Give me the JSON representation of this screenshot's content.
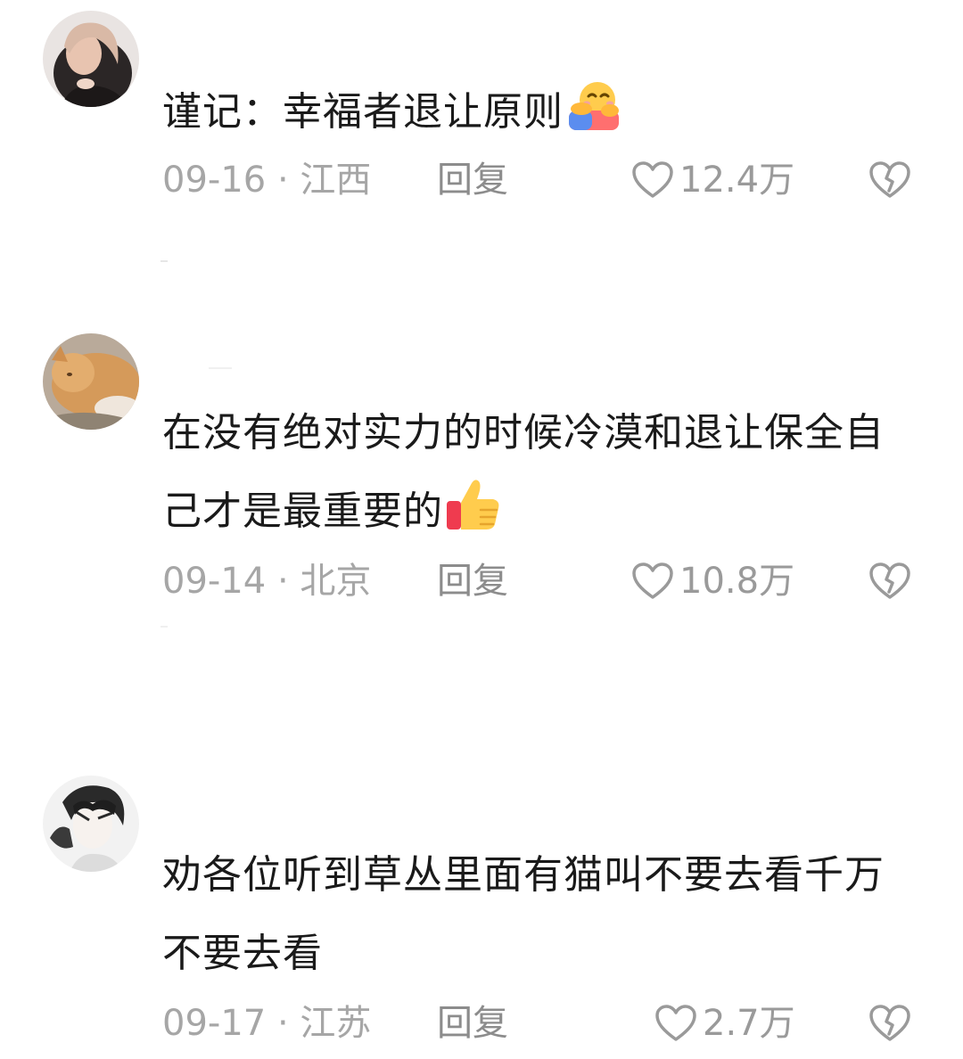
{
  "comments": [
    {
      "text": "谨记：幸福者退让原则",
      "emoji": "hugging-face-emoji",
      "date": "09-16",
      "location": "江西",
      "reply_label": "回复",
      "likes": "12.4万"
    },
    {
      "text": "在没有绝对实力的时候冷漠和退让保全自己才是最重要的",
      "emoji": "thumbs-up-emoji",
      "date": "09-14",
      "location": "北京",
      "reply_label": "回复",
      "likes": "10.8万"
    },
    {
      "text": "劝各位听到草丛里面有猫叫不要去看千万不要去看",
      "emoji": "",
      "date": "09-17",
      "location": "江苏",
      "reply_label": "回复",
      "likes": "2.7万"
    }
  ],
  "separator": " · ",
  "colors": {
    "text": "#1a1a1a",
    "meta": "#a6a6a6",
    "icon": "#9a9a9a"
  }
}
